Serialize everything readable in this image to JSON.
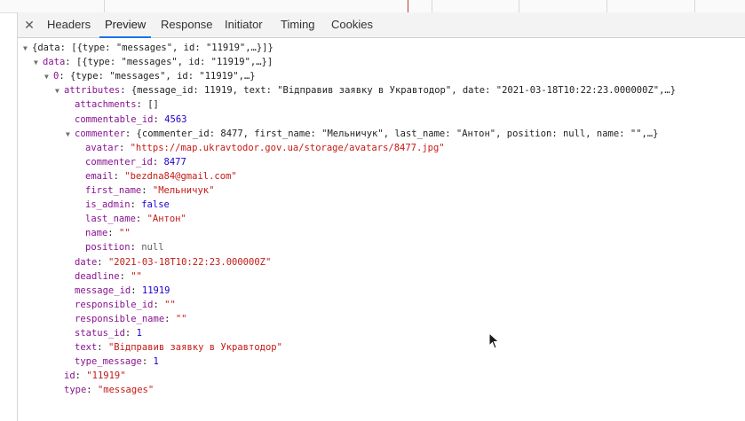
{
  "tabs": [
    "Headers",
    "Preview",
    "Response",
    "Initiator",
    "Timing",
    "Cookies"
  ],
  "active_tab": "Preview",
  "tree": [
    {
      "indent": 0,
      "tri": "down",
      "parts": [
        [
          "p",
          "{data: [{type: \"messages\", id: \"11919\",…}]}"
        ]
      ]
    },
    {
      "indent": 1,
      "tri": "down",
      "parts": [
        [
          "k",
          "data"
        ],
        [
          "p",
          ": [{type: \"messages\", id: \"11919\",…}]"
        ]
      ]
    },
    {
      "indent": 2,
      "tri": "down",
      "parts": [
        [
          "k",
          "0"
        ],
        [
          "p",
          ": {type: \"messages\", id: \"11919\",…}"
        ]
      ]
    },
    {
      "indent": 3,
      "tri": "down",
      "parts": [
        [
          "k",
          "attributes"
        ],
        [
          "p",
          ": {message_id: 11919, text: \"Відправив заявку в Укравтодор\", date: \"2021-03-18T10:22:23.000000Z\",…}"
        ]
      ]
    },
    {
      "indent": 4,
      "tri": "none",
      "parts": [
        [
          "k",
          "attachments"
        ],
        [
          "p",
          ": []"
        ]
      ]
    },
    {
      "indent": 4,
      "tri": "none",
      "parts": [
        [
          "k",
          "commentable_id"
        ],
        [
          "p",
          ": "
        ],
        [
          "n",
          "4563"
        ]
      ]
    },
    {
      "indent": 4,
      "tri": "down",
      "parts": [
        [
          "k",
          "commenter"
        ],
        [
          "p",
          ": {commenter_id: 8477, first_name: \"Мельничук\", last_name: \"Антон\", position: null, name: \"\",…}"
        ]
      ]
    },
    {
      "indent": 5,
      "tri": "none",
      "parts": [
        [
          "k",
          "avatar"
        ],
        [
          "p",
          ": "
        ],
        [
          "s",
          "\"https://map.ukravtodor.gov.ua/storage/avatars/8477.jpg\""
        ]
      ]
    },
    {
      "indent": 5,
      "tri": "none",
      "parts": [
        [
          "k",
          "commenter_id"
        ],
        [
          "p",
          ": "
        ],
        [
          "n",
          "8477"
        ]
      ]
    },
    {
      "indent": 5,
      "tri": "none",
      "parts": [
        [
          "k",
          "email"
        ],
        [
          "p",
          ": "
        ],
        [
          "s",
          "\"bezdna84@gmail.com\""
        ]
      ]
    },
    {
      "indent": 5,
      "tri": "none",
      "parts": [
        [
          "k",
          "first_name"
        ],
        [
          "p",
          ": "
        ],
        [
          "s",
          "\"Мельничук\""
        ]
      ]
    },
    {
      "indent": 5,
      "tri": "none",
      "parts": [
        [
          "k",
          "is_admin"
        ],
        [
          "p",
          ": "
        ],
        [
          "kw",
          "false"
        ]
      ]
    },
    {
      "indent": 5,
      "tri": "none",
      "parts": [
        [
          "k",
          "last_name"
        ],
        [
          "p",
          ": "
        ],
        [
          "s",
          "\"Антон\""
        ]
      ]
    },
    {
      "indent": 5,
      "tri": "none",
      "parts": [
        [
          "k",
          "name"
        ],
        [
          "p",
          ": "
        ],
        [
          "s",
          "\"\""
        ]
      ]
    },
    {
      "indent": 5,
      "tri": "none",
      "parts": [
        [
          "k",
          "position"
        ],
        [
          "p",
          ": "
        ],
        [
          "nl",
          "null"
        ]
      ]
    },
    {
      "indent": 4,
      "tri": "none",
      "parts": [
        [
          "k",
          "date"
        ],
        [
          "p",
          ": "
        ],
        [
          "s",
          "\"2021-03-18T10:22:23.000000Z\""
        ]
      ]
    },
    {
      "indent": 4,
      "tri": "none",
      "parts": [
        [
          "k",
          "deadline"
        ],
        [
          "p",
          ": "
        ],
        [
          "s",
          "\"\""
        ]
      ]
    },
    {
      "indent": 4,
      "tri": "none",
      "parts": [
        [
          "k",
          "message_id"
        ],
        [
          "p",
          ": "
        ],
        [
          "n",
          "11919"
        ]
      ]
    },
    {
      "indent": 4,
      "tri": "none",
      "parts": [
        [
          "k",
          "responsible_id"
        ],
        [
          "p",
          ": "
        ],
        [
          "s",
          "\"\""
        ]
      ]
    },
    {
      "indent": 4,
      "tri": "none",
      "parts": [
        [
          "k",
          "responsible_name"
        ],
        [
          "p",
          ": "
        ],
        [
          "s",
          "\"\""
        ]
      ]
    },
    {
      "indent": 4,
      "tri": "none",
      "parts": [
        [
          "k",
          "status_id"
        ],
        [
          "p",
          ": "
        ],
        [
          "n",
          "1"
        ]
      ]
    },
    {
      "indent": 4,
      "tri": "none",
      "parts": [
        [
          "k",
          "text"
        ],
        [
          "p",
          ": "
        ],
        [
          "s",
          "\"Відправив заявку в Укравтодор\""
        ]
      ]
    },
    {
      "indent": 4,
      "tri": "none",
      "parts": [
        [
          "k",
          "type_message"
        ],
        [
          "p",
          ": "
        ],
        [
          "n",
          "1"
        ]
      ]
    },
    {
      "indent": 3,
      "tri": "none",
      "parts": [
        [
          "k",
          "id"
        ],
        [
          "p",
          ": "
        ],
        [
          "s",
          "\"11919\""
        ]
      ]
    },
    {
      "indent": 3,
      "tri": "none",
      "parts": [
        [
          "k",
          "type"
        ],
        [
          "p",
          ": "
        ],
        [
          "s",
          "\"messages\""
        ]
      ]
    }
  ]
}
